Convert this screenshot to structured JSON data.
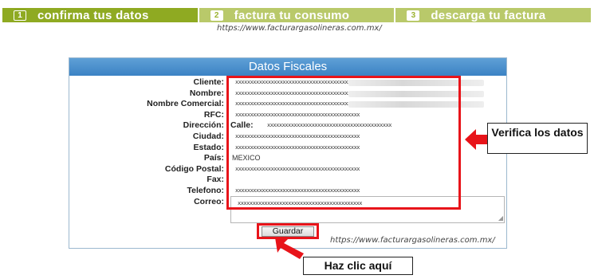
{
  "steps": [
    {
      "num": "1",
      "label": "confirma tus datos",
      "active": true
    },
    {
      "num": "2",
      "label": "factura tu consumo",
      "active": false
    },
    {
      "num": "3",
      "label": "descarga tu factura",
      "active": false
    }
  ],
  "watermark": "https://www.facturargasolineras.com.mx/",
  "panel": {
    "title": "Datos Fiscales",
    "fields": [
      {
        "label": "Cliente:",
        "value": "xxxxxxxxxxxxxxxxxxxxxxxxxxxxxxxxxxxxxxxxxx"
      },
      {
        "label": "Nombre:",
        "value": "xxxxxxxxxxxxxxxxxxxxxxxxxxxxxxxxxxxxxxxxxx"
      },
      {
        "label": "Nombre Comercial:",
        "value": "xxxxxxxxxxxxxxxxxxxxxxxxxxxxxxxxxxxxxxxxxx"
      },
      {
        "label": "RFC:",
        "value": "xxxxxxxxxxxxxxxxxxxxxxxxxxxxxxxxxxxxxxxxxx"
      },
      {
        "label": "Dirección:",
        "prefix": "Calle:",
        "value": "xxxxxxxxxxxxxxxxxxxxxxxxxxxxxxxxxxxxxxxxxx"
      },
      {
        "label": "Ciudad:",
        "value": "xxxxxxxxxxxxxxxxxxxxxxxxxxxxxxxxxxxxxxxxxx"
      },
      {
        "label": "Estado:",
        "value": "xxxxxxxxxxxxxxxxxxxxxxxxxxxxxxxxxxxxxxxxxx"
      },
      {
        "label": "País:",
        "value": "MEXICO"
      },
      {
        "label": "Código Postal:",
        "value": "xxxxxxxxxxxxxxxxxxxxxxxxxxxxxxxxxxxxxxxxxx"
      },
      {
        "label": "Fax:",
        "value": ""
      },
      {
        "label": "Telefono:",
        "value": "xxxxxxxxxxxxxxxxxxxxxxxxxxxxxxxxxxxxxxxxxx"
      },
      {
        "label": "Correo:",
        "value": "xxxxxxxxxxxxxxxxxxxxxxxxxxxxxxxxxxxxxxxxxx"
      }
    ],
    "save_label": "Guardar"
  },
  "callouts": {
    "verify": "Verifica los datos",
    "click": "Haz clic aquí"
  },
  "colors": {
    "highlight": "#e8141a",
    "step_active": "#8faa22",
    "step_inactive": "#b9c96a",
    "header": "#4a90d0"
  }
}
